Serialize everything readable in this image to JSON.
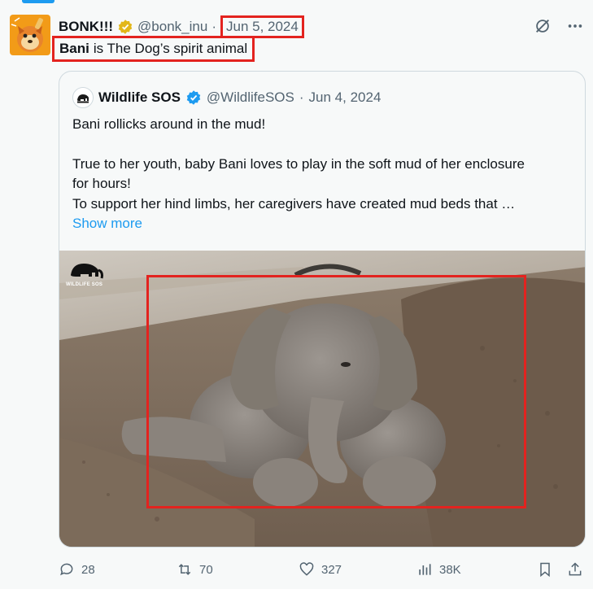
{
  "tweet": {
    "author_name": "BONK!!!",
    "author_handle": "@bonk_inu",
    "separator": "·",
    "date": "Jun 5, 2024",
    "text_bold": "Bani",
    "text_rest": "is The Dog’s spirit animal"
  },
  "quote": {
    "author_name": "Wildlife SOS",
    "author_handle": "@WildlifeSOS",
    "separator": "·",
    "date": "Jun 4, 2024",
    "line1": "Bani rollicks around in the mud!",
    "line2": "True to her youth, baby Bani loves to play in the soft mud of her enclosure for hours!",
    "line3": "To support her hind limbs, her caregivers have created mud beds that …",
    "show_more": "Show more",
    "watermark": "WILDLIFE SOS"
  },
  "actions": {
    "replies": "28",
    "reposts": "70",
    "likes": "327",
    "views": "38K"
  },
  "colors": {
    "accent": "#1d9bf0",
    "highlight": "#e3231f",
    "verified_gold": "#e2b719",
    "verified_blue": "#1d9bf0"
  }
}
